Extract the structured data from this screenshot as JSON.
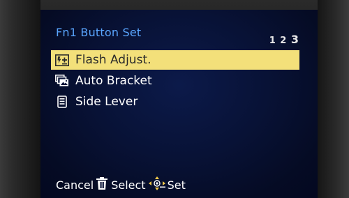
{
  "screen": {
    "title": "Fn1 Button Set",
    "page_indicator": {
      "pages": [
        "1",
        "2"
      ],
      "current": "3"
    }
  },
  "menu": {
    "items": [
      {
        "label": "Flash Adjust.",
        "icon": "flash-adjust-icon",
        "selected": true
      },
      {
        "label": "Auto Bracket",
        "icon": "auto-bracket-icon",
        "selected": false
      },
      {
        "label": "Side Lever",
        "icon": "side-lever-icon",
        "selected": false
      }
    ]
  },
  "footer": {
    "cancel_label": "Cancel",
    "select_label": "Select",
    "set_label": "Set"
  },
  "colors": {
    "title": "#5aa6ff",
    "highlight": "#f3e07a",
    "screen_bg": "#081236"
  }
}
